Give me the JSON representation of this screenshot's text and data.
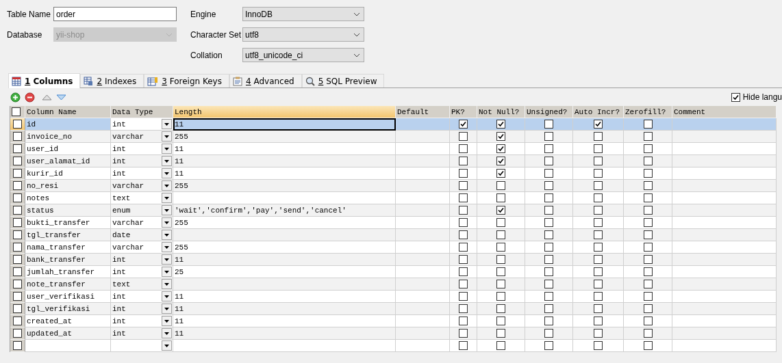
{
  "form": {
    "table_name": {
      "label": "Table Name",
      "value": "order"
    },
    "database": {
      "label": "Database",
      "value": "yii-shop",
      "disabled": true
    },
    "engine": {
      "label": "Engine",
      "value": "InnoDB",
      "disabled": false
    },
    "character_set": {
      "label": "Character Set",
      "value": "utf8",
      "disabled": false
    },
    "collation": {
      "label": "Collation",
      "value": "utf8_unicode_ci",
      "disabled": false
    }
  },
  "tabs": [
    {
      "number": "1",
      "label": "Columns",
      "selected": true
    },
    {
      "number": "2",
      "label": "Indexes",
      "selected": false
    },
    {
      "number": "3",
      "label": "Foreign Keys",
      "selected": false
    },
    {
      "number": "4",
      "label": "Advanced",
      "selected": false
    },
    {
      "number": "5",
      "label": "SQL Preview",
      "selected": false
    }
  ],
  "hide_language": {
    "label": "Hide langu",
    "checked": true
  },
  "table": {
    "select_all": {
      "checked": false
    },
    "columns": [
      {
        "label": "Column Name",
        "highlighted": false
      },
      {
        "label": "Data Type",
        "highlighted": false
      },
      {
        "label": "Length",
        "highlighted": true
      },
      {
        "label": "Default",
        "highlighted": false
      },
      {
        "label": "PK?",
        "highlighted": false
      },
      {
        "label": "Not Null?",
        "highlighted": false
      },
      {
        "label": "Unsigned?",
        "highlighted": false
      },
      {
        "label": "Auto Incr?",
        "highlighted": false
      },
      {
        "label": "Zerofill?",
        "highlighted": false
      },
      {
        "label": "Comment",
        "highlighted": false
      }
    ],
    "rows": [
      {
        "name": "id",
        "type": "int",
        "length": "11",
        "pk": true,
        "not_null": true,
        "unsigned": false,
        "auto_incr": true,
        "zerofill": false,
        "selected": true
      },
      {
        "name": "invoice_no",
        "type": "varchar",
        "length": "255",
        "pk": false,
        "not_null": true,
        "unsigned": false,
        "auto_incr": false,
        "zerofill": false,
        "selected": false
      },
      {
        "name": "user_id",
        "type": "int",
        "length": "11",
        "pk": false,
        "not_null": true,
        "unsigned": false,
        "auto_incr": false,
        "zerofill": false,
        "selected": false
      },
      {
        "name": "user_alamat_id",
        "type": "int",
        "length": "11",
        "pk": false,
        "not_null": true,
        "unsigned": false,
        "auto_incr": false,
        "zerofill": false,
        "selected": false
      },
      {
        "name": "kurir_id",
        "type": "int",
        "length": "11",
        "pk": false,
        "not_null": true,
        "unsigned": false,
        "auto_incr": false,
        "zerofill": false,
        "selected": false
      },
      {
        "name": "no_resi",
        "type": "varchar",
        "length": "255",
        "pk": false,
        "not_null": false,
        "unsigned": false,
        "auto_incr": false,
        "zerofill": false,
        "selected": false
      },
      {
        "name": "notes",
        "type": "text",
        "pk": false,
        "not_null": false,
        "unsigned": false,
        "auto_incr": false,
        "zerofill": false,
        "selected": false
      },
      {
        "name": "status",
        "type": "enum",
        "length": "'wait','confirm','pay','send','cancel'",
        "pk": false,
        "not_null": true,
        "unsigned": false,
        "auto_incr": false,
        "zerofill": false,
        "selected": false
      },
      {
        "name": "bukti_transfer",
        "type": "varchar",
        "length": "255",
        "pk": false,
        "not_null": false,
        "unsigned": false,
        "auto_incr": false,
        "zerofill": false,
        "selected": false
      },
      {
        "name": "tgl_transfer",
        "type": "date",
        "pk": false,
        "not_null": false,
        "unsigned": false,
        "auto_incr": false,
        "zerofill": false,
        "selected": false
      },
      {
        "name": "nama_transfer",
        "type": "varchar",
        "length": "255",
        "pk": false,
        "not_null": false,
        "unsigned": false,
        "auto_incr": false,
        "zerofill": false,
        "selected": false
      },
      {
        "name": "bank_transfer",
        "type": "int",
        "length": "11",
        "pk": false,
        "not_null": false,
        "unsigned": false,
        "auto_incr": false,
        "zerofill": false,
        "selected": false
      },
      {
        "name": "jumlah_transfer",
        "type": "int",
        "length": "25",
        "pk": false,
        "not_null": false,
        "unsigned": false,
        "auto_incr": false,
        "zerofill": false,
        "selected": false
      },
      {
        "name": "note_transfer",
        "type": "text",
        "pk": false,
        "not_null": false,
        "unsigned": false,
        "auto_incr": false,
        "zerofill": false,
        "selected": false
      },
      {
        "name": "user_verifikasi",
        "type": "int",
        "length": "11",
        "pk": false,
        "not_null": false,
        "unsigned": false,
        "auto_incr": false,
        "zerofill": false,
        "selected": false
      },
      {
        "name": "tgl_verifikasi",
        "type": "int",
        "length": "11",
        "pk": false,
        "not_null": false,
        "unsigned": false,
        "auto_incr": false,
        "zerofill": false,
        "selected": false
      },
      {
        "name": "created_at",
        "type": "int",
        "length": "11",
        "pk": false,
        "not_null": false,
        "unsigned": false,
        "auto_incr": false,
        "zerofill": false,
        "selected": false
      },
      {
        "name": "updated_at",
        "type": "int",
        "length": "11",
        "pk": false,
        "not_null": false,
        "unsigned": false,
        "auto_incr": false,
        "zerofill": false,
        "selected": false
      },
      {
        "pk": false,
        "not_null": false,
        "unsigned": false,
        "auto_incr": false,
        "zerofill": false,
        "selected": false
      }
    ]
  }
}
